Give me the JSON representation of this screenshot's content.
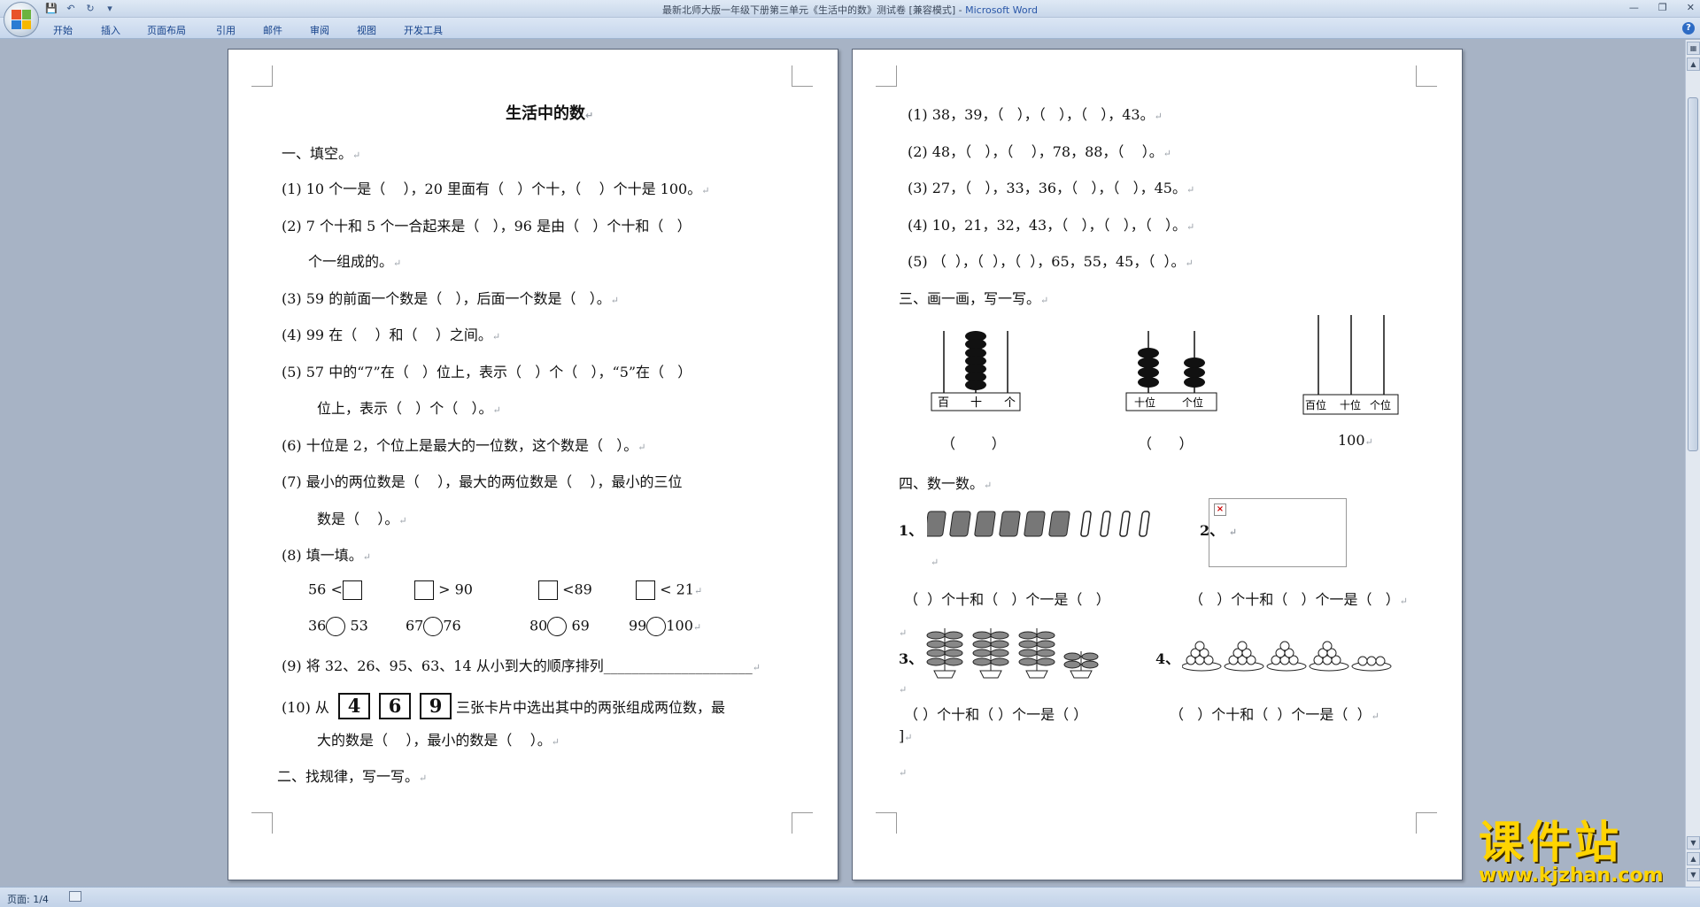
{
  "window": {
    "title": "最新北师大版一年级下册第三单元《生活中的数》测试卷 [兼容模式]",
    "title_sep": " - ",
    "app_name": "Microsoft Word"
  },
  "ribbon": {
    "tabs": [
      "开始",
      "插入",
      "页面布局",
      "引用",
      "邮件",
      "审阅",
      "视图",
      "开发工具"
    ]
  },
  "status": {
    "page": "页面: 1/4"
  },
  "watermark": {
    "text_cn": "课件站",
    "url": "www.kjzhan.com"
  },
  "left_page": {
    "title": "生活中的数",
    "lines": [
      "一、填空。",
      "(1) 10 个一是（    ），20 里面有（   ）个十，（    ）个十是 100。",
      "(2) 7 个十和 5 个一合起来是（   ），96 是由（   ）个十和（   ）",
      "个一组成的。",
      "(3) 59 的前面一个数是（   ），后面一个数是（   ）。",
      "(4) 99 在（    ）和（    ）之间。",
      "(5) 57 中的“7”在（   ）位上，表示（   ）个（   ），“5”在（   ）",
      "位上，表示（   ）个（   ）。",
      "(6) 十位是 2，个位上是最大的一位数，这个数是（   ）。",
      "(7) 最小的两位数是（    ），最大的两位数是（    ），最小的三位",
      "数是（    ）。",
      "(8) 填一填。"
    ],
    "compare_row1": [
      "56 <",
      "> 90",
      "<89",
      "< 21"
    ],
    "compare_row2": [
      "36",
      "53",
      "67",
      "76",
      "80",
      "69",
      "99",
      "100"
    ],
    "line9": "(9) 将 32、26、95、63、14 从小到大的顺序排列_____________________",
    "line10_prefix": "(10) 从",
    "cards": [
      "4",
      "6",
      "9"
    ],
    "line10_suffix": "三张卡片中选出其中的两张组成两位数，最",
    "line10_cont": "大的数是（    ），最小的数是（    ）。",
    "section2": "二、找规律，写一写。"
  },
  "right_page": {
    "seq_lines": [
      "(1) 38，39，（   ），（   ），（   ），43。",
      "(2) 48，（   ），（    ），78，88，（    ）。",
      "(3) 27，（   ），33，36，（   ），（   ），45。",
      "(4) 10，21，32，43，（   ），（   ），（   ）。",
      "(5) （  ），（  ），（  ），65，55，45，（  ）。"
    ],
    "section3": "三、画一画，写一写。",
    "abacus1": {
      "labels": [
        "百",
        "十",
        "个"
      ],
      "answer": "（        ）"
    },
    "abacus2": {
      "labels": [
        "十位",
        "个位"
      ],
      "answer": "（      ）"
    },
    "abacus3": {
      "labels": [
        "百位",
        "十位",
        "个位"
      ],
      "answer": "100"
    },
    "section4": "四、数一数。",
    "item1": "1、",
    "item2": "2、",
    "item3": "3、",
    "item4": "4、",
    "count_line": "（  ）个十和（   ）个一是（   ）",
    "count_line_b": "（   ）个十和（   ）个一是（   ）",
    "count_line2": "（ ）个十和（ ）个一是（ ）",
    "count_line2_b": "（   ）个十和（  ）个一是（  ）"
  }
}
